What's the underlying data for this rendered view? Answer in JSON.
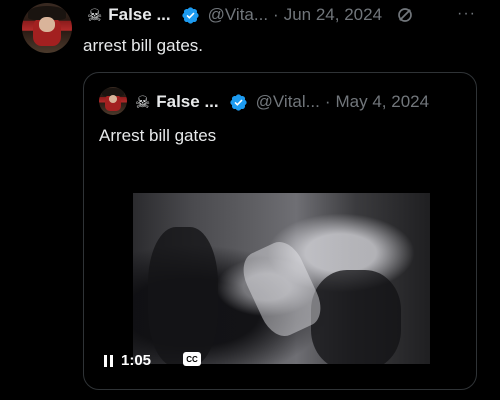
{
  "outer_tweet": {
    "skull_glyph": "☠",
    "display_name": "False ...",
    "handle": "@Vita...",
    "separator": "·",
    "date": "Jun 24, 2024",
    "text": "arrest bill gates."
  },
  "quoted_tweet": {
    "skull_glyph": "☠",
    "display_name": "False ...",
    "handle": "@Vital...",
    "separator": "·",
    "date": "May 4, 2024",
    "text": "Arrest bill gates"
  },
  "video": {
    "time": "1:05",
    "cc_label": "CC"
  },
  "icons": {
    "more": "···",
    "verified_color": "#1d9bf0"
  }
}
